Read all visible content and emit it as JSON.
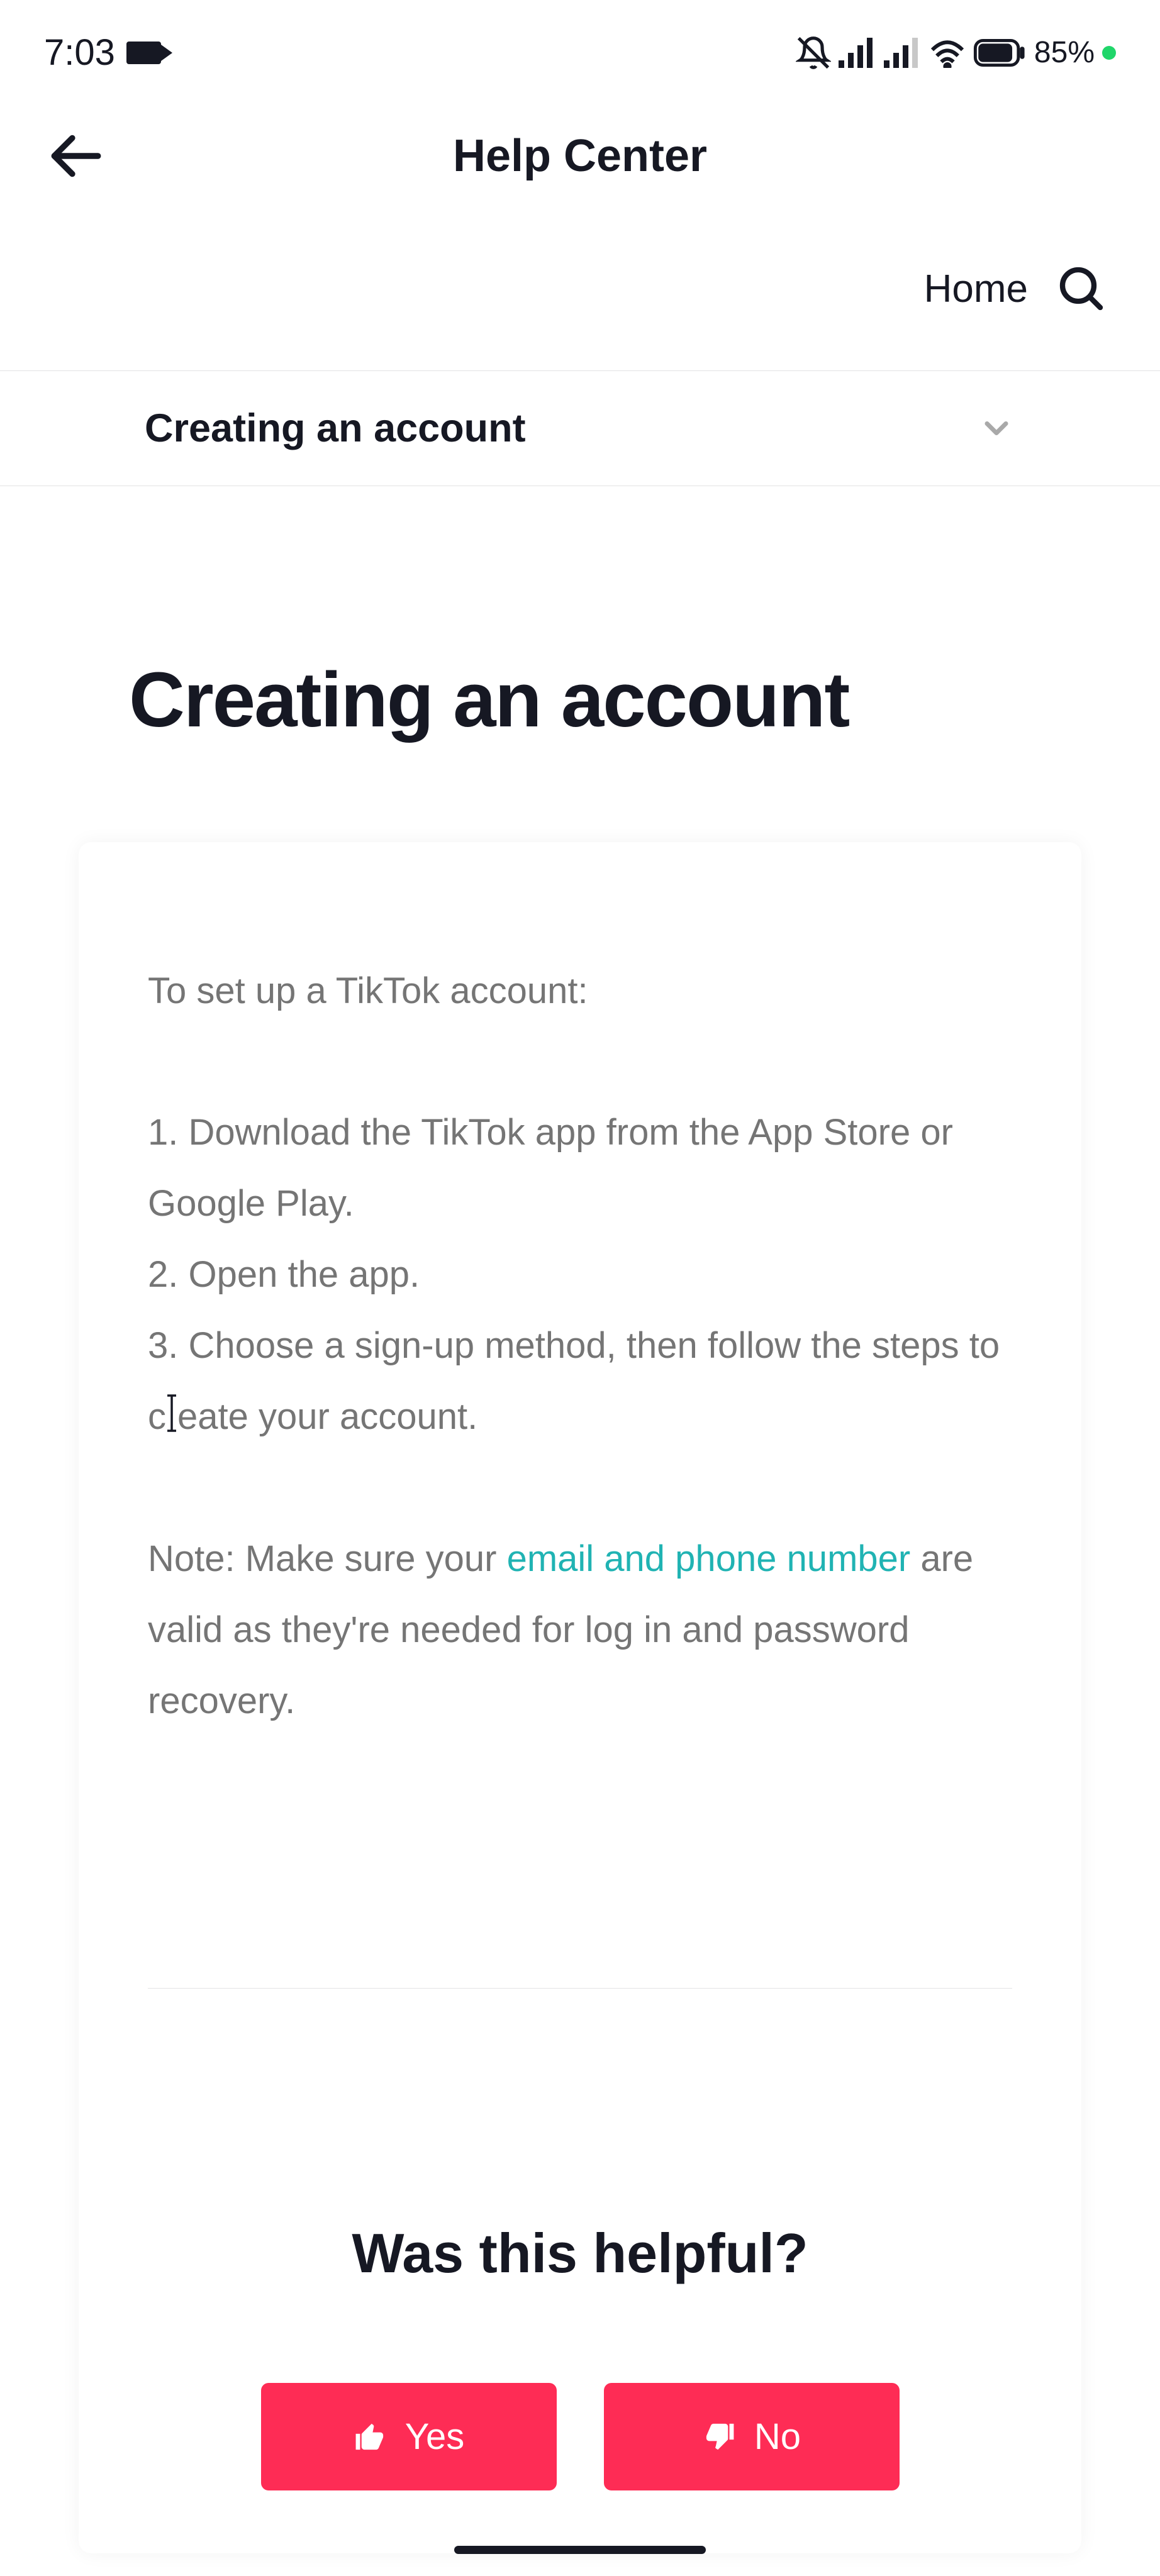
{
  "status_bar": {
    "time": "7:03",
    "battery": "85%"
  },
  "nav": {
    "title": "Help Center",
    "home_label": "Home"
  },
  "breadcrumb": {
    "label": "Creating an account"
  },
  "page": {
    "title": "Creating an account"
  },
  "article": {
    "intro": "To set up a TikTok account:",
    "step1": "1. Download the TikTok app from the App Store or Google Play.",
    "step2": "2. Open the app.",
    "step3_a": "3. Choose a sign-up method, then follow the steps to c",
    "step3_b": "eate your account.",
    "note_a": "Note: Make sure your ",
    "note_link": "email and phone number",
    "note_b": " are valid as they're needed for log in and password recovery."
  },
  "feedback": {
    "title": "Was this helpful?",
    "yes_label": "Yes",
    "no_label": "No"
  }
}
